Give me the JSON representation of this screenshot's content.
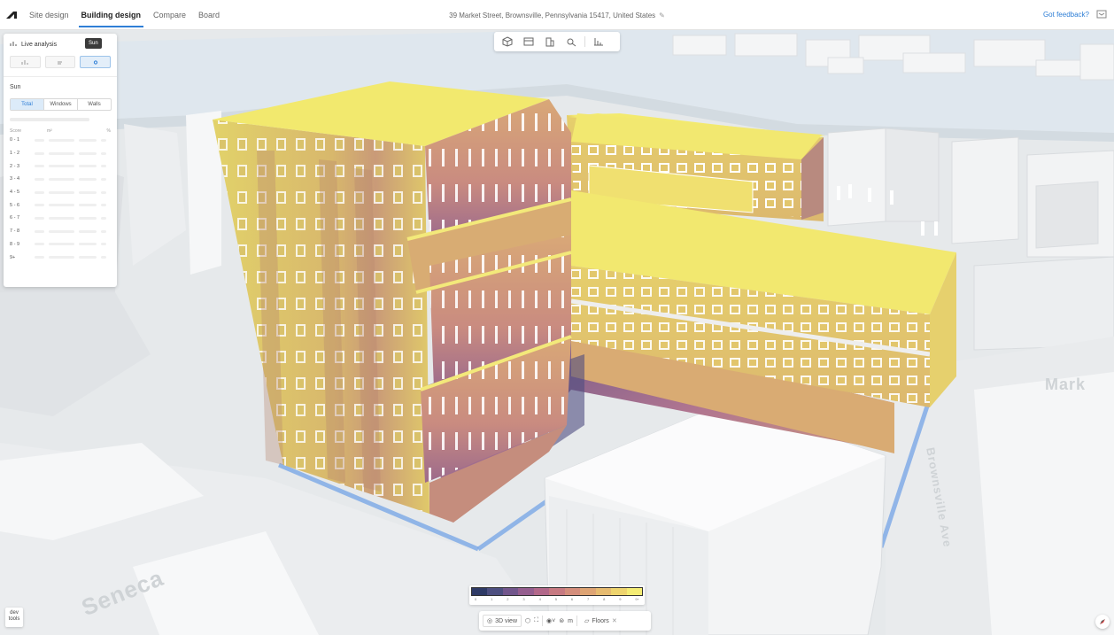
{
  "topbar": {
    "nav": [
      "Site design",
      "Building design",
      "Compare",
      "Board"
    ],
    "active_nav": "Building design",
    "address": "39 Market Street, Brownsville, Pennsylvania 15417, United States",
    "feedback": "Got feedback?"
  },
  "panel": {
    "title": "Live analysis",
    "tooltip": "Sun",
    "section": "Sun",
    "segments": [
      "Total",
      "Windows",
      "Walls"
    ],
    "table_headers": [
      "Score",
      "m²",
      "%"
    ],
    "rows": [
      "0 - 1",
      "1 - 2",
      "2 - 3",
      "3 - 4",
      "4 - 5",
      "5 - 6",
      "6 - 7",
      "7 - 8",
      "8 - 9",
      "9+"
    ]
  },
  "legend": {
    "colors": [
      "#2e3a66",
      "#4d4f80",
      "#72568c",
      "#955e8f",
      "#b2688a",
      "#c77a82",
      "#d48e7c",
      "#dea474",
      "#e6bb70",
      "#eed46e",
      "#f4ec74"
    ],
    "ticks": [
      "0",
      "1",
      "2",
      "3",
      "4",
      "5",
      "6",
      "7",
      "8",
      "9",
      "9+"
    ]
  },
  "bottom_toolbar": {
    "view_label": "3D view",
    "floors_label": "Floors"
  },
  "devtools": {
    "line1": "dev",
    "line2": "tools"
  },
  "streets": {
    "right": "Brownsville Ave",
    "far_right": "Mark",
    "bottom_left": "Seneca"
  },
  "colors": {
    "accent": "#2f7fd6",
    "roof": "#f1ea6e",
    "facade": "#e0cc6a",
    "facade_dark": "#c98e7a"
  }
}
